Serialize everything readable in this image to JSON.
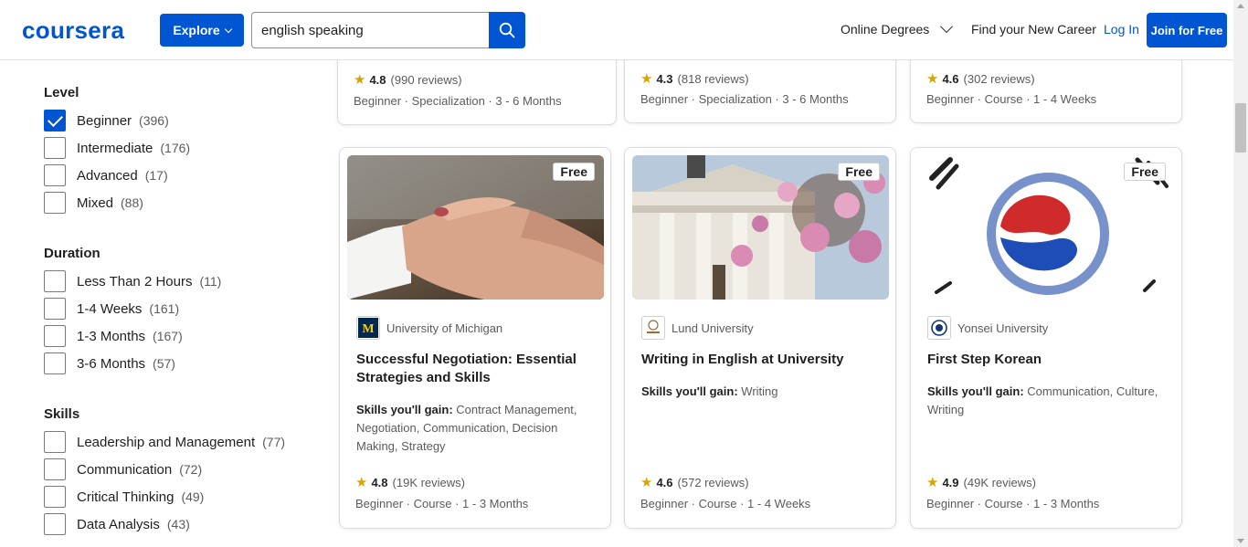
{
  "header": {
    "logo": "coursera",
    "explore_label": "Explore",
    "search_value": "english speaking",
    "nav_online_degrees": "Online Degrees",
    "nav_find_career": "Find your New Career",
    "nav_login": "Log In",
    "join_label": "Join for Free"
  },
  "filters": {
    "level": {
      "title": "Level",
      "options": [
        {
          "label": "Beginner",
          "count": "(396)",
          "checked": true
        },
        {
          "label": "Intermediate",
          "count": "(176)",
          "checked": false
        },
        {
          "label": "Advanced",
          "count": "(17)",
          "checked": false
        },
        {
          "label": "Mixed",
          "count": "(88)",
          "checked": false
        }
      ]
    },
    "duration": {
      "title": "Duration",
      "options": [
        {
          "label": "Less Than 2 Hours",
          "count": "(11)"
        },
        {
          "label": "1-4 Weeks",
          "count": "(161)"
        },
        {
          "label": "1-3 Months",
          "count": "(167)"
        },
        {
          "label": "3-6 Months",
          "count": "(57)"
        }
      ]
    },
    "skills": {
      "title": "Skills",
      "options": [
        {
          "label": "Leadership and Management",
          "count": "(77)"
        },
        {
          "label": "Communication",
          "count": "(72)"
        },
        {
          "label": "Critical Thinking",
          "count": "(49)"
        },
        {
          "label": "Data Analysis",
          "count": "(43)"
        }
      ]
    }
  },
  "top_cards": [
    {
      "rating": "4.8",
      "reviews": "(990 reviews)",
      "meta": "Beginner · Specialization · 3 - 6 Months"
    },
    {
      "rating": "4.3",
      "reviews": "(818 reviews)",
      "meta": "Beginner · Specialization · 3 - 6 Months"
    },
    {
      "rating": "4.6",
      "reviews": "(302 reviews)",
      "meta": "Beginner · Course · 1 - 4 Weeks"
    }
  ],
  "cards": [
    {
      "badge": "Free",
      "partner": "University of Michigan",
      "title": "Successful Negotiation: Essential Strategies and Skills",
      "skills_prefix": "Skills you'll gain:",
      "skills": "Contract Management, Negotiation, Communication, Decision Making, Strategy",
      "rating": "4.8",
      "reviews": "(19K reviews)",
      "meta": "Beginner · Course · 1 - 3 Months"
    },
    {
      "badge": "Free",
      "partner": "Lund University",
      "title": "Writing in English at University",
      "skills_prefix": "Skills you'll gain:",
      "skills": "Writing",
      "rating": "4.6",
      "reviews": "(572 reviews)",
      "meta": "Beginner · Course · 1 - 4 Weeks"
    },
    {
      "badge": "Free",
      "partner": "Yonsei University",
      "title": "First Step Korean",
      "skills_prefix": "Skills you'll gain:",
      "skills": "Communication, Culture, Writing",
      "rating": "4.9",
      "reviews": "(49K reviews)",
      "meta": "Beginner · Course · 1 - 3 Months"
    }
  ],
  "colors": {
    "brand": "#0056d2",
    "star": "#d9a400"
  },
  "icons": {
    "search": "search-icon",
    "star": "star-icon",
    "chevron": "chevron-down-icon"
  }
}
